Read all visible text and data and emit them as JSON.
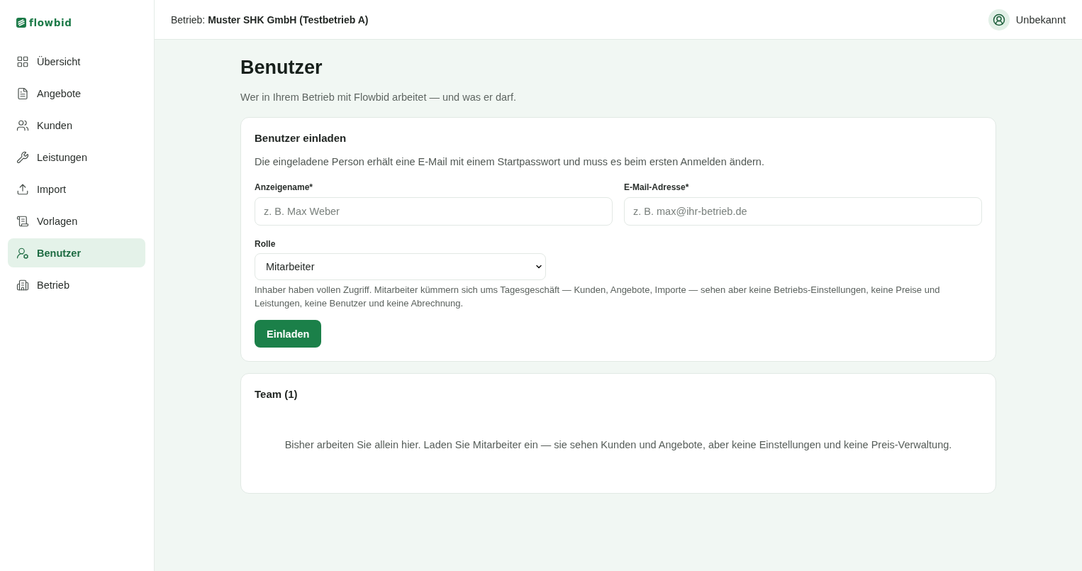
{
  "sidebar": {
    "logo": "flowbid",
    "items": [
      {
        "label": "Übersicht",
        "selected": false
      },
      {
        "label": "Angebote",
        "selected": false
      },
      {
        "label": "Kunden",
        "selected": false
      },
      {
        "label": "Leistungen",
        "selected": false
      },
      {
        "label": "Import",
        "selected": false
      },
      {
        "label": "Vorlagen",
        "selected": false
      },
      {
        "label": "Benutzer",
        "selected": true
      },
      {
        "label": "Betrieb",
        "selected": false
      }
    ]
  },
  "header": {
    "business": "Betrieb: **Muster SHK GmbH (Testbetrieb A)**",
    "user": "Unbekannt"
  },
  "page": {
    "title": "Benutzer",
    "subtitle": "Wer in Ihrem Betrieb mit Flowbid arbeitet — und was er darf."
  },
  "invite_card": {
    "title": "Benutzer einladen",
    "description": "Die eingeladene Person erhält eine E-Mail mit einem Startpasswort und muss es beim ersten Anmelden ändern.",
    "fields": [
      {
        "label": "Anzeigename*",
        "placeholder": "z. B. Max Weber"
      },
      {
        "label": "E-Mail-Adresse*",
        "placeholder": "z. B. max@ihr-betrieb.de"
      }
    ],
    "role": {
      "label": "Rolle",
      "value": "Mitarbeiter",
      "hint": "Inhaber haben vollen Zugriff. Mitarbeiter kümmern sich ums Tagesgeschäft — Kunden, Angebote, Importe — sehen aber keine Betriebs-Einstellungen, keine Preise und Leistungen, keine Benutzer und keine Abrechnung."
    },
    "button": "Einladen"
  },
  "team_card": {
    "title": "Team (1)",
    "empty_text": "Bisher arbeiten Sie allein hier. Laden Sie Mitarbeiter ein — sie sehen Kunden und Angebote, aber keine Einstellungen und keine Preis-Verwaltung."
  }
}
